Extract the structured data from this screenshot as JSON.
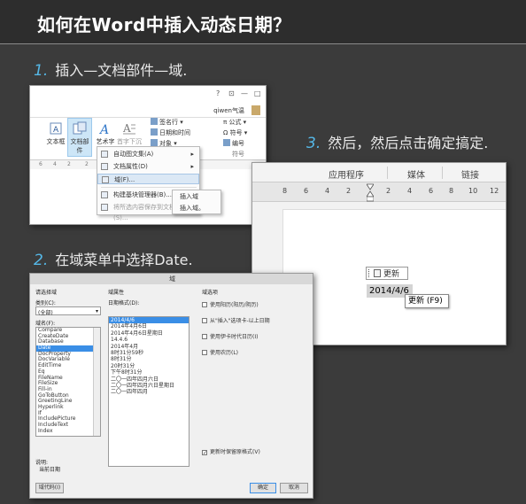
{
  "header": {
    "title": "如何在Word中插入动态日期？"
  },
  "steps": [
    {
      "num": "1.",
      "text": "插入—文档部件—域."
    },
    {
      "num": "2.",
      "text": "在域菜单中选择Date."
    },
    {
      "num": "3.",
      "text": "然后，然后点击确定搞定."
    }
  ],
  "shot1": {
    "window_controls": [
      "?",
      "⊡",
      "—",
      "□"
    ],
    "user": "qiwen气温",
    "ribbon_buttons": [
      {
        "label": "文本框",
        "icon": "textbox-icon"
      },
      {
        "label": "文档部件",
        "icon": "quickparts-icon",
        "selected": true
      },
      {
        "label": "艺术字",
        "icon": "wordart-icon"
      },
      {
        "label": "首字下沉",
        "icon": "dropcap-icon"
      }
    ],
    "small_items": [
      {
        "label": "签名行 ▾",
        "icon": "signature-icon"
      },
      {
        "label": "日期和时间",
        "icon": "datetime-icon"
      },
      {
        "label": "对象 ▾",
        "icon": "object-icon"
      },
      {
        "label": "π 公式 ▾",
        "icon": "equation-icon"
      },
      {
        "label": "Ω 符号 ▾",
        "icon": "symbol-icon"
      },
      {
        "label": "编号",
        "icon": "number-icon"
      },
      {
        "label": "符号",
        "icon": ""
      }
    ],
    "ruler_ticks": [
      "6",
      "4",
      "2",
      "2"
    ],
    "menu": [
      {
        "label": "自动图文集(A)",
        "arrow": "▸",
        "highlight": false,
        "dim": false
      },
      {
        "label": "文档属性(D)",
        "arrow": "▸",
        "highlight": false,
        "dim": false
      },
      {
        "label": "域(F)...",
        "arrow": "",
        "highlight": true,
        "dim": false
      },
      {
        "label": "构建基块管理器(B)...",
        "arrow": "",
        "highlight": false,
        "dim": false
      },
      {
        "label": "将所选内容保存到文档部件库(S)...",
        "arrow": "",
        "highlight": false,
        "dim": true
      }
    ],
    "submenu": [
      "插入域",
      "插入域。"
    ]
  },
  "shot2": {
    "tabs": [
      "应用程序",
      "媒体",
      "链接"
    ],
    "ruler_numbers": [
      "8",
      "6",
      "4",
      "2",
      "2",
      "4",
      "6",
      "8",
      "10",
      "12"
    ],
    "field_tag": "更新",
    "date_value": "2014/4/6",
    "tooltip": "更新 (F9)"
  },
  "shot3": {
    "dialog_title": "域",
    "choose_field": "请选择域",
    "category_label": "类别(C):",
    "category_value": "(全部)",
    "fieldnames_label": "域名(F):",
    "field_names": [
      "Compare",
      "CreateDate",
      "Database",
      "Date",
      "DocProperty",
      "DocVariable",
      "EditTime",
      "Eq",
      "FileName",
      "FileSize",
      "Fill-in",
      "GoToButton",
      "GreetingLine",
      "Hyperlink",
      "If",
      "IncludePicture",
      "IncludeText",
      "Index"
    ],
    "selected_field": "Date",
    "field_props_label": "域属性",
    "date_format_label": "日期格式(D):",
    "date_formats": [
      "2014/4/6",
      "2014年4月6日",
      "2014年4月6日星期日",
      "14.4.6",
      "2014年4月",
      "8时31分59秒",
      "8时31分",
      "20时31分",
      "下午8时31分",
      "二〇一四年四月六日",
      "二〇一四年四月六日星期日",
      "二〇一四年四月"
    ],
    "field_options_label": "域选项",
    "options": [
      "使用阳历(阳历/阴历)",
      "从\"插入\"选项卡-以上日期",
      "使用伊卡时代日历(I)",
      "使用农历(L)"
    ],
    "preserve_format": "更新时保留原格式(V)",
    "desc_label": "说明:",
    "desc_value": "当前日期",
    "field_codes_button": "域代码(I)",
    "ok_button": "确定",
    "cancel_button": "取消"
  }
}
